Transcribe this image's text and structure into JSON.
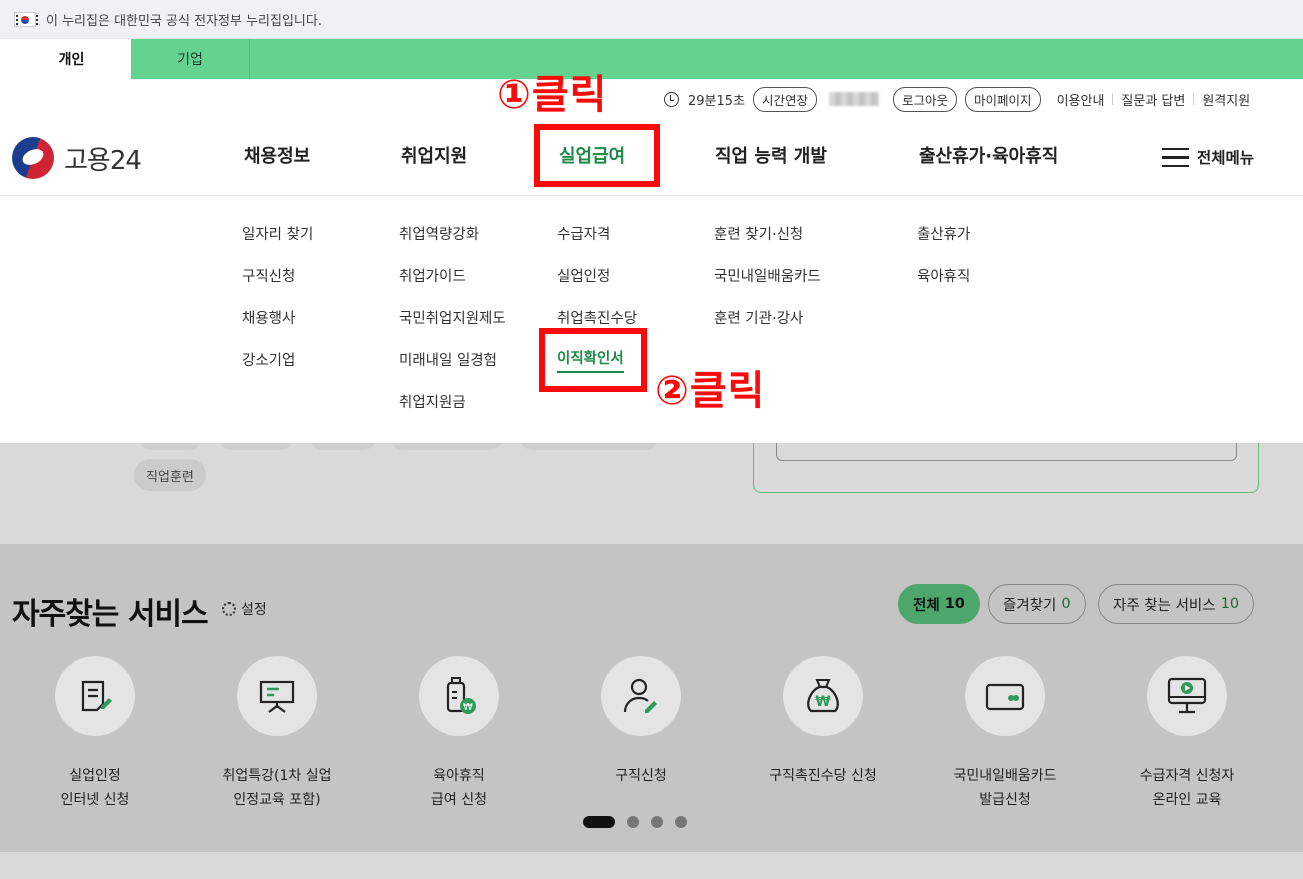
{
  "gov_banner": {
    "text": "이 누리집은 대한민국 공식 전자정부 누리집입니다."
  },
  "audience_tabs": [
    {
      "label": "개인"
    },
    {
      "label": "기업"
    }
  ],
  "utility": {
    "timer": "29분15초",
    "extend": "시간연장",
    "logout": "로그아웃",
    "mypage": "마이페이지",
    "links": [
      "이용안내",
      "질문과 답변",
      "원격지원"
    ]
  },
  "logo": {
    "text": "고용24"
  },
  "gnb": [
    "채용정보",
    "취업지원",
    "실업급여",
    "직업 능력 개발",
    "출산휴가·육아휴직"
  ],
  "all_menu": "전체메뉴",
  "mega_menu": {
    "col1": [
      "일자리 찾기",
      "구직신청",
      "채용행사",
      "강소기업"
    ],
    "col2": [
      "취업역량강화",
      "취업가이드",
      "국민취업지원제도",
      "미래내일 일경험",
      "취업지원금"
    ],
    "col3": [
      "수급자격",
      "실업인정",
      "취업촉진수당",
      "이직확인서"
    ],
    "col4": [
      "훈련 찾기·신청",
      "국민내일배움카드",
      "훈련 기관·강사"
    ],
    "col5": [
      "출산휴가",
      "육아휴직"
    ]
  },
  "annotations": {
    "step1": "①클릭",
    "step2": "②클릭"
  },
  "chip": "직업훈련",
  "frequent": {
    "title": "자주찾는 서비스",
    "setting": "설정",
    "tabs": [
      {
        "label": "전체",
        "count": "10"
      },
      {
        "label": "즐겨찾기",
        "count": "0"
      },
      {
        "label": "자주 찾는 서비스",
        "count": "10"
      }
    ],
    "items": [
      {
        "icon": "document-edit-icon",
        "line1": "실업인정",
        "line2": "인터넷 신청"
      },
      {
        "icon": "lecture-board-icon",
        "line1": "취업특강(1차 실업",
        "line2": "인정교육 포함)"
      },
      {
        "icon": "baby-bottle-won-icon",
        "line1": "육아휴직",
        "line2": "급여 신청"
      },
      {
        "icon": "person-edit-icon",
        "line1": "구직신청",
        "line2": ""
      },
      {
        "icon": "money-bag-won-icon",
        "line1": "구직촉진수당 신청",
        "line2": ""
      },
      {
        "icon": "card-icon",
        "line1": "국민내일배움카드",
        "line2": "발급신청"
      },
      {
        "icon": "monitor-play-icon",
        "line1": "수급자격 신청자",
        "line2": "온라인 교육"
      }
    ]
  },
  "colors": {
    "brand_green": "#64d38f",
    "active_green": "#1e8a47",
    "annotation_red": "#fb0a0a"
  }
}
